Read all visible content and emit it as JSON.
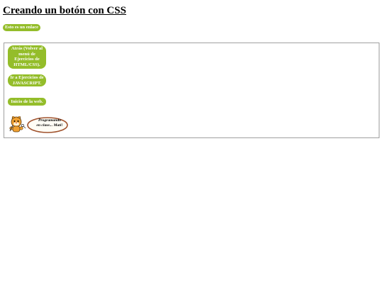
{
  "page": {
    "title": "Creando un botón con CSS"
  },
  "top_link": {
    "label": "Esto es un enlace"
  },
  "nav": {
    "buttons": [
      {
        "label": "Atrás (Volver al menú de Ejercicios de HTML/CSS)."
      },
      {
        "label": "Ir a Ejercicios de JAVASCRIPT."
      },
      {
        "label": "Inicio de la web."
      }
    ]
  },
  "logo": {
    "line1": "Programando",
    "line2": "en clase... Mati!"
  },
  "colors": {
    "button_green": "#94bd2a",
    "logo_ring": "#a0522d",
    "mascot_orange": "#f0a030"
  }
}
